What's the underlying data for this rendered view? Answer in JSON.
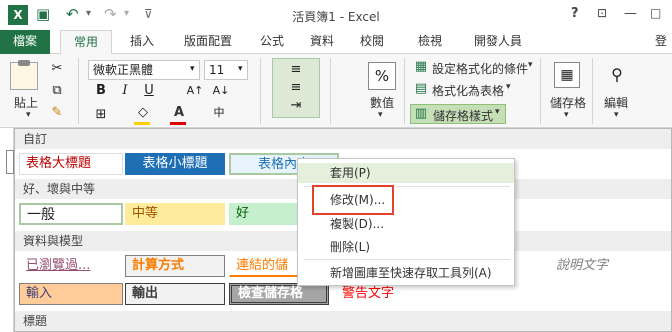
{
  "window": {
    "title": "活頁簿1 - Excel",
    "help": "?",
    "sign_in": "登"
  },
  "tabs": [
    "檔案",
    "常用",
    "插入",
    "版面配置",
    "公式",
    "資料",
    "校閱",
    "檢視",
    "開發人員"
  ],
  "ribbon": {
    "paste": "貼上",
    "font_name": "微軟正黑體",
    "font_size": "11",
    "bold": "B",
    "italic": "I",
    "underline": "U",
    "font_color_letter": "A",
    "conditional_formatting": "設定格式化的條件",
    "format_as_table": "格式化為表格",
    "cell_styles": "儲存格樣式",
    "number": "數值",
    "percent": "%",
    "cells": "儲存格",
    "editing": "編輯"
  },
  "gallery": {
    "sections": {
      "custom": "自訂",
      "good_bad": "好、壞與中等",
      "data_model": "資料與模型",
      "titles": "標題"
    },
    "custom_styles": [
      "表格大標題",
      "表格小標題",
      "表格內容"
    ],
    "good_bad_styles": [
      "一般",
      "中等",
      "好"
    ],
    "data_model_row1": [
      "已瀏覽過...",
      "計算方式",
      "連結的儲",
      "說明文字"
    ],
    "data_model_row2": [
      "輸入",
      "輸出",
      "檢查儲存格",
      "警告文字"
    ]
  },
  "context_menu": {
    "items": [
      "套用(P)",
      "修改(M)...",
      "複製(D)...",
      "刪除(L)",
      "新增圖庫至快速存取工具列(A)"
    ],
    "highlight_color": "#e3412e"
  },
  "colors": {
    "excel_green": "#217346",
    "custom_style_blue": "#1f6fb5",
    "neutral_fill": "#ffeb9c",
    "good_fill": "#c6efce",
    "input_fill": "#ffcc99",
    "check_fill": "#a5a5a5"
  }
}
